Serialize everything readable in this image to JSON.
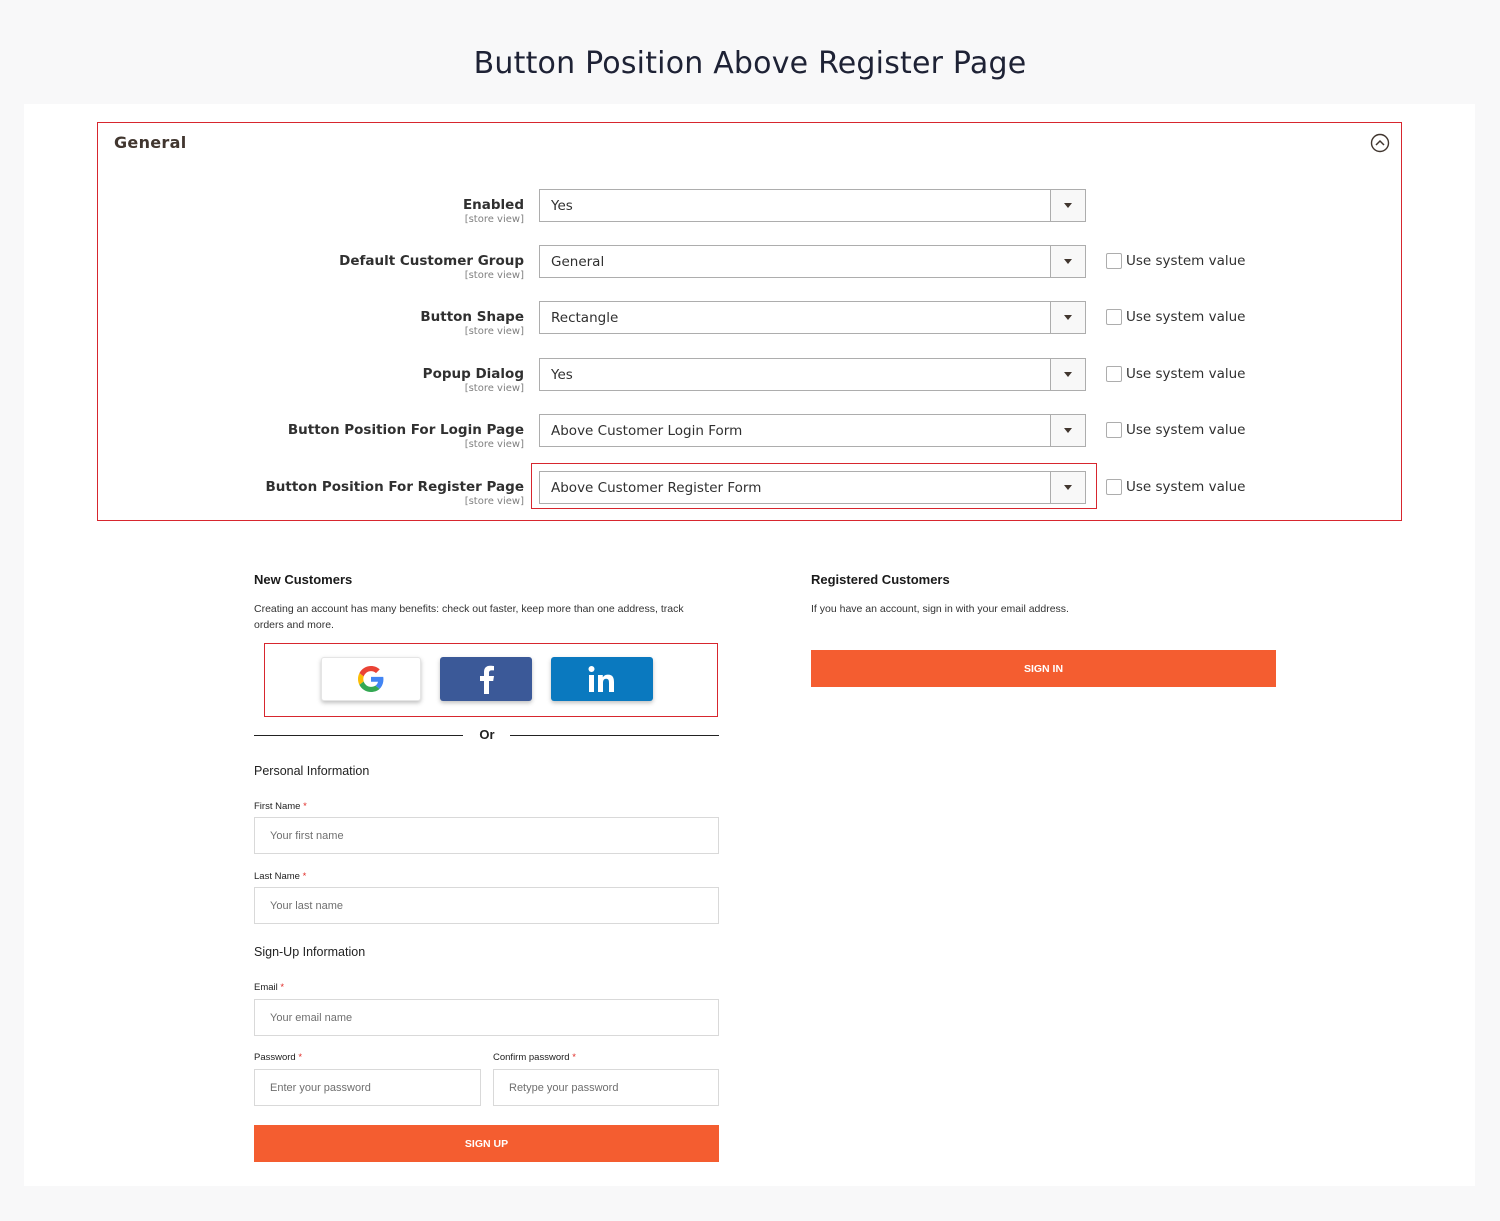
{
  "page": {
    "title": "Button Position Above Register Page"
  },
  "config": {
    "section_title": "General",
    "rows": [
      {
        "label": "Enabled",
        "scope": "[store view]",
        "value": "Yes",
        "use_system_value": null
      },
      {
        "label": "Default Customer Group",
        "scope": "[store view]",
        "value": "General",
        "use_system_value": "Use system value"
      },
      {
        "label": "Button Shape",
        "scope": "[store view]",
        "value": "Rectangle",
        "use_system_value": "Use system value"
      },
      {
        "label": "Popup Dialog",
        "scope": "[store view]",
        "value": "Yes",
        "use_system_value": "Use system value"
      },
      {
        "label": "Button Position For Login Page",
        "scope": "[store view]",
        "value": "Above Customer Login Form",
        "use_system_value": "Use system value"
      },
      {
        "label": "Button Position For Register Page",
        "scope": "[store view]",
        "value": "Above Customer Register Form",
        "use_system_value": "Use system value"
      }
    ],
    "highlight_color": "#d7262e"
  },
  "new_customers": {
    "title": "New Customers",
    "text": "Creating an account has many benefits: check out faster, keep more than one address, track orders and more.",
    "social": [
      "google-icon",
      "facebook-icon",
      "linkedin-icon"
    ],
    "or_label": "Or",
    "personal_heading": "Personal Information",
    "first_name": {
      "label": "First Name",
      "placeholder": "Your first name"
    },
    "last_name": {
      "label": "Last Name",
      "placeholder": "Your last name"
    },
    "signup_heading": "Sign-Up Information",
    "email": {
      "label": "Email",
      "placeholder": "Your email name"
    },
    "password": {
      "label": "Password",
      "placeholder": "Enter your password"
    },
    "confirm_password": {
      "label": "Confirm password",
      "placeholder": "Retype your password"
    },
    "required_mark": "*",
    "signup_button": "SIGN UP"
  },
  "registered_customers": {
    "title": "Registered Customers",
    "text": "If you have an account, sign in with your email address.",
    "signin_button": "SIGN IN"
  },
  "colors": {
    "accent": "#f45d30",
    "facebook": "#3b5998",
    "linkedin": "#0a79bf"
  }
}
